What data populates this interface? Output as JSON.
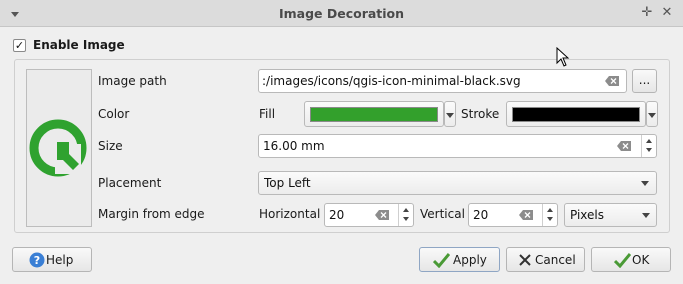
{
  "window": {
    "title": "Image Decoration"
  },
  "enable": {
    "checked_glyph": "✓",
    "label": "Enable Image"
  },
  "labels": {
    "image_path": "Image path",
    "color": "Color",
    "fill": "Fill",
    "stroke": "Stroke",
    "size": "Size",
    "placement": "Placement",
    "margin": "Margin from edge",
    "horizontal": "Horizontal",
    "vertical": "Vertical"
  },
  "values": {
    "image_path": ":/images/icons/qgis-icon-minimal-black.svg",
    "size": "16.00 mm",
    "placement": "Top Left",
    "horizontal": "20",
    "vertical": "20",
    "units": "Pixels"
  },
  "colors": {
    "fill": "#33a02c",
    "stroke": "#000000",
    "logo": "#2fa22f"
  },
  "buttons": {
    "browse": "...",
    "help": "Help",
    "apply": "Apply",
    "cancel": "Cancel",
    "ok": "OK"
  }
}
